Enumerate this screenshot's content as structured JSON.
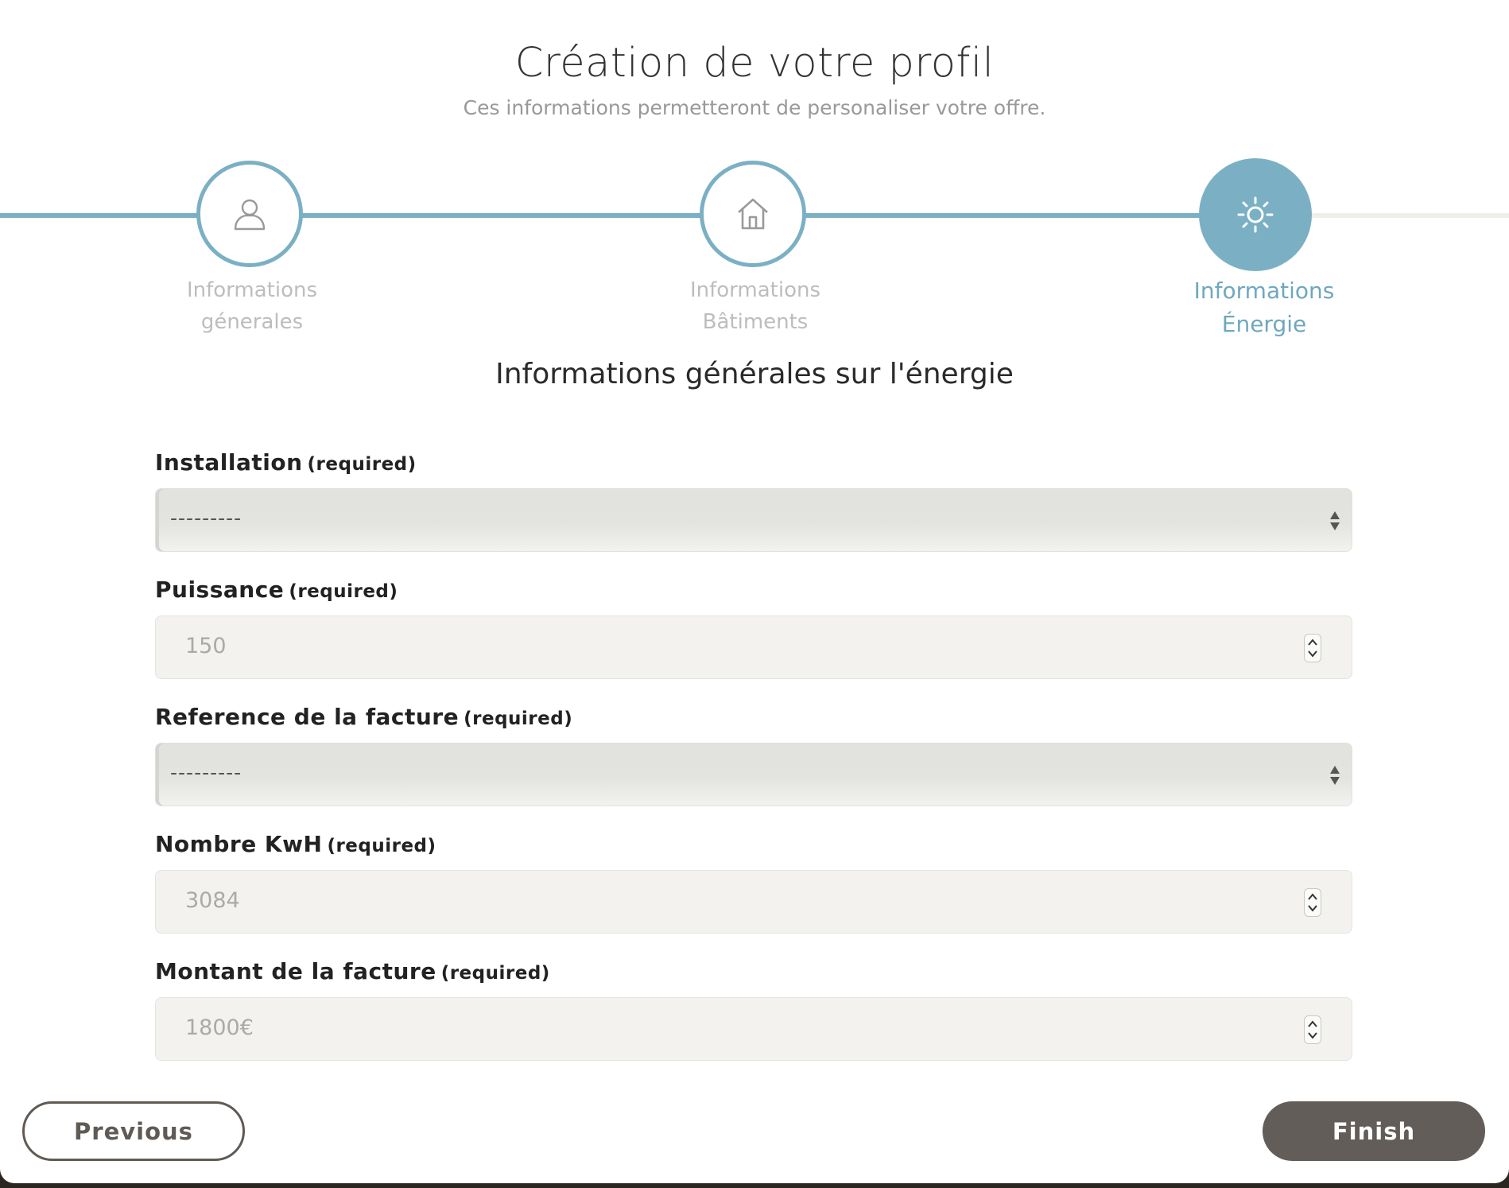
{
  "header": {
    "title": "Création de votre profil",
    "subtitle": "Ces informations permetteront de personaliser votre offre."
  },
  "stepper": {
    "steps": [
      {
        "line1": "Informations",
        "line2": "génerales",
        "icon": "user-icon",
        "state": "completed"
      },
      {
        "line1": "Informations",
        "line2": "Bâtiments",
        "icon": "house-icon",
        "state": "completed"
      },
      {
        "line1": "Informations",
        "line2": "Énergie",
        "icon": "sun-icon",
        "state": "active"
      }
    ],
    "colors": {
      "active": "#7bb0c4",
      "inactive_text": "#bdbdbd",
      "track": "#eeeeea"
    }
  },
  "section": {
    "title": "Informations générales sur l'énergie"
  },
  "form": {
    "required_tag": "(required)",
    "fields": [
      {
        "label": "Installation",
        "type": "select",
        "value": "---------"
      },
      {
        "label": "Puissance",
        "type": "number",
        "value": "150"
      },
      {
        "label": "Reference de la facture",
        "type": "select",
        "value": "---------"
      },
      {
        "label": "Nombre KwH",
        "type": "number",
        "value": "3084"
      },
      {
        "label": "Montant de la facture",
        "type": "number",
        "value": "1800€"
      }
    ]
  },
  "actions": {
    "previous_label": "Previous",
    "finish_label": "Finish"
  },
  "colors": {
    "primary_button": "#625d58",
    "accent": "#7bb0c4"
  }
}
